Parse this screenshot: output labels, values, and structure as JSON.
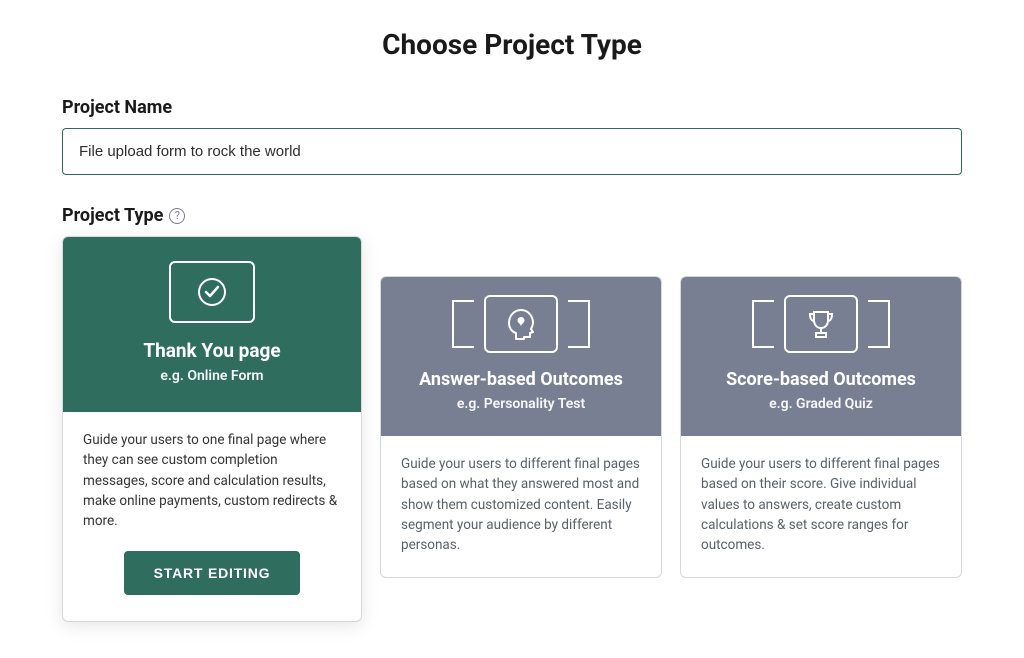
{
  "page": {
    "title": "Choose Project Type"
  },
  "projectName": {
    "label": "Project Name",
    "value": "File upload form to rock the world"
  },
  "projectType": {
    "label": "Project Type"
  },
  "cards": [
    {
      "title": "Thank You page",
      "subtitle": "e.g. Online Form",
      "description": "Guide your users to one final page where they can see custom completion messages, score and calculation results, make online payments, custom redirects & more.",
      "cta": "START EDITING"
    },
    {
      "title": "Answer-based Outcomes",
      "subtitle": "e.g. Personality Test",
      "description": "Guide your users to different final pages based on what they answered most and show them customized content. Easily segment your audience by different personas."
    },
    {
      "title": "Score-based Outcomes",
      "subtitle": "e.g. Graded Quiz",
      "description": "Guide your users to different final pages based on their score. Give individual values to answers, create custom calculations & set score ranges for outcomes."
    }
  ]
}
